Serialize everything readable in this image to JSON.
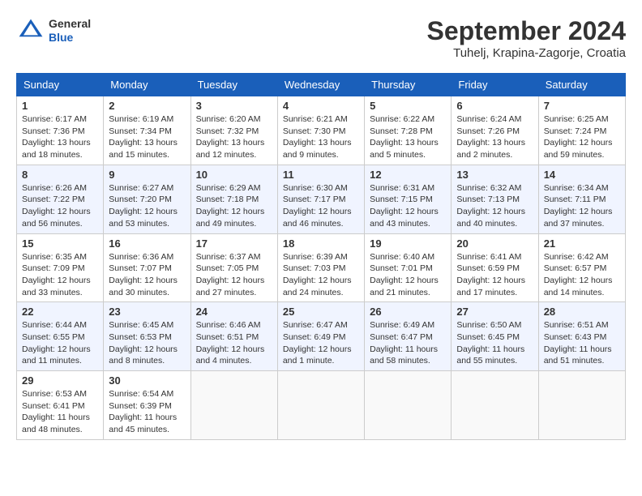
{
  "header": {
    "logo_general": "General",
    "logo_blue": "Blue",
    "month_year": "September 2024",
    "location": "Tuhelj, Krapina-Zagorje, Croatia"
  },
  "columns": [
    "Sunday",
    "Monday",
    "Tuesday",
    "Wednesday",
    "Thursday",
    "Friday",
    "Saturday"
  ],
  "weeks": [
    [
      {
        "day": "1",
        "info": "Sunrise: 6:17 AM\nSunset: 7:36 PM\nDaylight: 13 hours and 18 minutes."
      },
      {
        "day": "2",
        "info": "Sunrise: 6:19 AM\nSunset: 7:34 PM\nDaylight: 13 hours and 15 minutes."
      },
      {
        "day": "3",
        "info": "Sunrise: 6:20 AM\nSunset: 7:32 PM\nDaylight: 13 hours and 12 minutes."
      },
      {
        "day": "4",
        "info": "Sunrise: 6:21 AM\nSunset: 7:30 PM\nDaylight: 13 hours and 9 minutes."
      },
      {
        "day": "5",
        "info": "Sunrise: 6:22 AM\nSunset: 7:28 PM\nDaylight: 13 hours and 5 minutes."
      },
      {
        "day": "6",
        "info": "Sunrise: 6:24 AM\nSunset: 7:26 PM\nDaylight: 13 hours and 2 minutes."
      },
      {
        "day": "7",
        "info": "Sunrise: 6:25 AM\nSunset: 7:24 PM\nDaylight: 12 hours and 59 minutes."
      }
    ],
    [
      {
        "day": "8",
        "info": "Sunrise: 6:26 AM\nSunset: 7:22 PM\nDaylight: 12 hours and 56 minutes."
      },
      {
        "day": "9",
        "info": "Sunrise: 6:27 AM\nSunset: 7:20 PM\nDaylight: 12 hours and 53 minutes."
      },
      {
        "day": "10",
        "info": "Sunrise: 6:29 AM\nSunset: 7:18 PM\nDaylight: 12 hours and 49 minutes."
      },
      {
        "day": "11",
        "info": "Sunrise: 6:30 AM\nSunset: 7:17 PM\nDaylight: 12 hours and 46 minutes."
      },
      {
        "day": "12",
        "info": "Sunrise: 6:31 AM\nSunset: 7:15 PM\nDaylight: 12 hours and 43 minutes."
      },
      {
        "day": "13",
        "info": "Sunrise: 6:32 AM\nSunset: 7:13 PM\nDaylight: 12 hours and 40 minutes."
      },
      {
        "day": "14",
        "info": "Sunrise: 6:34 AM\nSunset: 7:11 PM\nDaylight: 12 hours and 37 minutes."
      }
    ],
    [
      {
        "day": "15",
        "info": "Sunrise: 6:35 AM\nSunset: 7:09 PM\nDaylight: 12 hours and 33 minutes."
      },
      {
        "day": "16",
        "info": "Sunrise: 6:36 AM\nSunset: 7:07 PM\nDaylight: 12 hours and 30 minutes."
      },
      {
        "day": "17",
        "info": "Sunrise: 6:37 AM\nSunset: 7:05 PM\nDaylight: 12 hours and 27 minutes."
      },
      {
        "day": "18",
        "info": "Sunrise: 6:39 AM\nSunset: 7:03 PM\nDaylight: 12 hours and 24 minutes."
      },
      {
        "day": "19",
        "info": "Sunrise: 6:40 AM\nSunset: 7:01 PM\nDaylight: 12 hours and 21 minutes."
      },
      {
        "day": "20",
        "info": "Sunrise: 6:41 AM\nSunset: 6:59 PM\nDaylight: 12 hours and 17 minutes."
      },
      {
        "day": "21",
        "info": "Sunrise: 6:42 AM\nSunset: 6:57 PM\nDaylight: 12 hours and 14 minutes."
      }
    ],
    [
      {
        "day": "22",
        "info": "Sunrise: 6:44 AM\nSunset: 6:55 PM\nDaylight: 12 hours and 11 minutes."
      },
      {
        "day": "23",
        "info": "Sunrise: 6:45 AM\nSunset: 6:53 PM\nDaylight: 12 hours and 8 minutes."
      },
      {
        "day": "24",
        "info": "Sunrise: 6:46 AM\nSunset: 6:51 PM\nDaylight: 12 hours and 4 minutes."
      },
      {
        "day": "25",
        "info": "Sunrise: 6:47 AM\nSunset: 6:49 PM\nDaylight: 12 hours and 1 minute."
      },
      {
        "day": "26",
        "info": "Sunrise: 6:49 AM\nSunset: 6:47 PM\nDaylight: 11 hours and 58 minutes."
      },
      {
        "day": "27",
        "info": "Sunrise: 6:50 AM\nSunset: 6:45 PM\nDaylight: 11 hours and 55 minutes."
      },
      {
        "day": "28",
        "info": "Sunrise: 6:51 AM\nSunset: 6:43 PM\nDaylight: 11 hours and 51 minutes."
      }
    ],
    [
      {
        "day": "29",
        "info": "Sunrise: 6:53 AM\nSunset: 6:41 PM\nDaylight: 11 hours and 48 minutes."
      },
      {
        "day": "30",
        "info": "Sunrise: 6:54 AM\nSunset: 6:39 PM\nDaylight: 11 hours and 45 minutes."
      },
      {
        "day": "",
        "info": ""
      },
      {
        "day": "",
        "info": ""
      },
      {
        "day": "",
        "info": ""
      },
      {
        "day": "",
        "info": ""
      },
      {
        "day": "",
        "info": ""
      }
    ]
  ]
}
